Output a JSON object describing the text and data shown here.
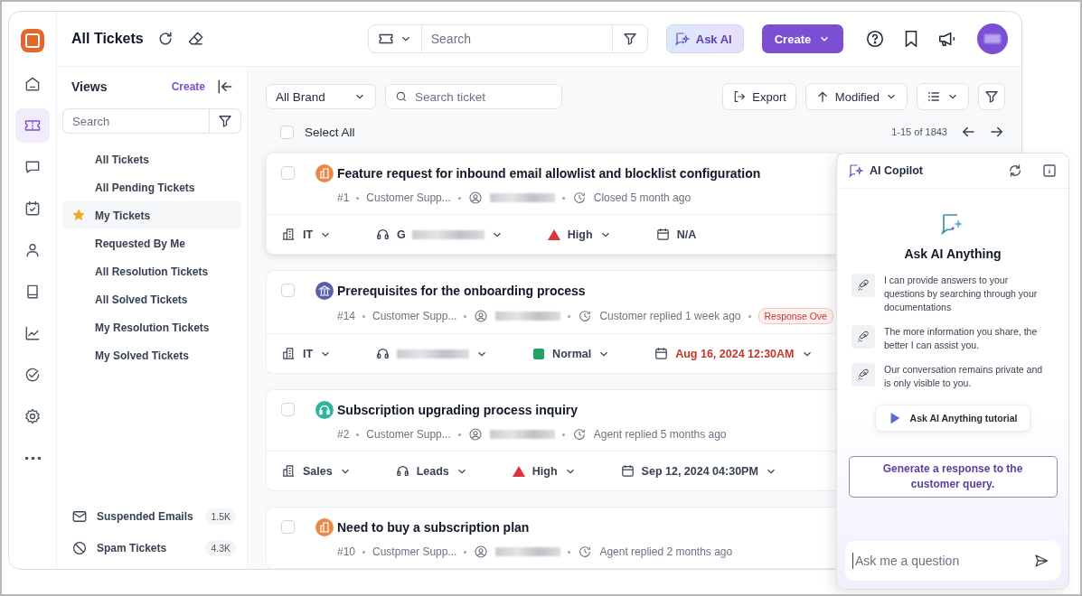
{
  "header": {
    "title": "All Tickets",
    "search_placeholder": "Search",
    "ask_ai": "Ask AI",
    "create": "Create"
  },
  "rail": [
    {
      "kind": "home",
      "selected": false
    },
    {
      "kind": "ticket",
      "selected": true
    },
    {
      "kind": "chat",
      "selected": false
    },
    {
      "kind": "calendar",
      "selected": false
    },
    {
      "kind": "person",
      "selected": false
    },
    {
      "kind": "book",
      "selected": false
    },
    {
      "kind": "chart",
      "selected": false
    },
    {
      "kind": "check",
      "selected": false
    },
    {
      "kind": "gear",
      "selected": false
    },
    {
      "kind": "more",
      "selected": false
    }
  ],
  "views": {
    "title": "Views",
    "create": "Create",
    "search_placeholder": "Search",
    "items": [
      {
        "label": "All Tickets",
        "selected": false
      },
      {
        "label": "All Pending Tickets",
        "selected": false
      },
      {
        "label": "My Tickets",
        "selected": true
      },
      {
        "label": "Requested By Me",
        "selected": false
      },
      {
        "label": "All Resolution Tickets",
        "selected": false
      },
      {
        "label": "All Solved Tickets",
        "selected": false
      },
      {
        "label": "My Resolution Tickets",
        "selected": false
      },
      {
        "label": "My Solved Tickets",
        "selected": false
      }
    ],
    "bottom": [
      {
        "label": "Suspended Emails",
        "count": "1.5K",
        "kind": "mail"
      },
      {
        "label": "Spam Tickets",
        "count": "4.3K",
        "kind": "ban"
      }
    ]
  },
  "toolbar": {
    "brand": "All Brand",
    "search_placeholder": "Search ticket",
    "export": "Export",
    "sort": "Modified",
    "select_all": "Select All",
    "select_all_checked": false,
    "range": "1-15 of 1843"
  },
  "tickets": [
    {
      "checked": false,
      "title": "Feature request for inbound email allowlist and blocklist configuration",
      "kind": "building",
      "color": "#e8894a",
      "number": "#1",
      "team": "Customer Supp...",
      "activity": "Closed 5 month ago",
      "footer": {
        "department": "IT",
        "agent": "G",
        "priority": {
          "label": "High",
          "kind": "high"
        },
        "due": {
          "text": "N/A",
          "overdue": false,
          "menu": false
        }
      }
    },
    {
      "checked": false,
      "title": "Prerequisites for the onboarding process",
      "kind": "bank",
      "color": "#5b5ea6",
      "number": "#14",
      "team": "Customer Supp...",
      "activity": "Customer replied 1 week ago",
      "badge": "Response Ove",
      "footer": {
        "department": "IT",
        "priority": {
          "label": "Normal",
          "kind": "normal"
        },
        "due": {
          "text": "Aug 16, 2024 12:30AM",
          "overdue": true,
          "menu": true
        }
      }
    },
    {
      "checked": false,
      "title": "Subscription upgrading process inquiry",
      "kind": "headset",
      "color": "#2fb59b",
      "number": "#2",
      "team": "Customer Supp...",
      "activity": "Agent replied 5 months ago",
      "footer": {
        "department": "Sales",
        "agent": "Leads",
        "priority": {
          "label": "High",
          "kind": "high"
        },
        "due": {
          "text": "Sep 12, 2024 04:30PM",
          "overdue": false,
          "menu": true
        }
      }
    },
    {
      "checked": false,
      "title": "Need to buy a subscription plan",
      "kind": "building",
      "color": "#e8894a",
      "number": "#10",
      "team": "Custpmer Supp...",
      "activity": "Agent replied 2 months ago"
    }
  ],
  "copilot": {
    "title": "AI Copilot",
    "heading": "Ask AI Anything",
    "tips": [
      "I can provide answers to your questions by searching through your documentations",
      "The more information you share, the better I can assist you.",
      "Our conversation remains private and is only visible to you."
    ],
    "tutorial": "Ask AI Anything tutorial",
    "suggestion": "Generate a response to the customer query.",
    "input_placeholder": "Ask me a question"
  }
}
